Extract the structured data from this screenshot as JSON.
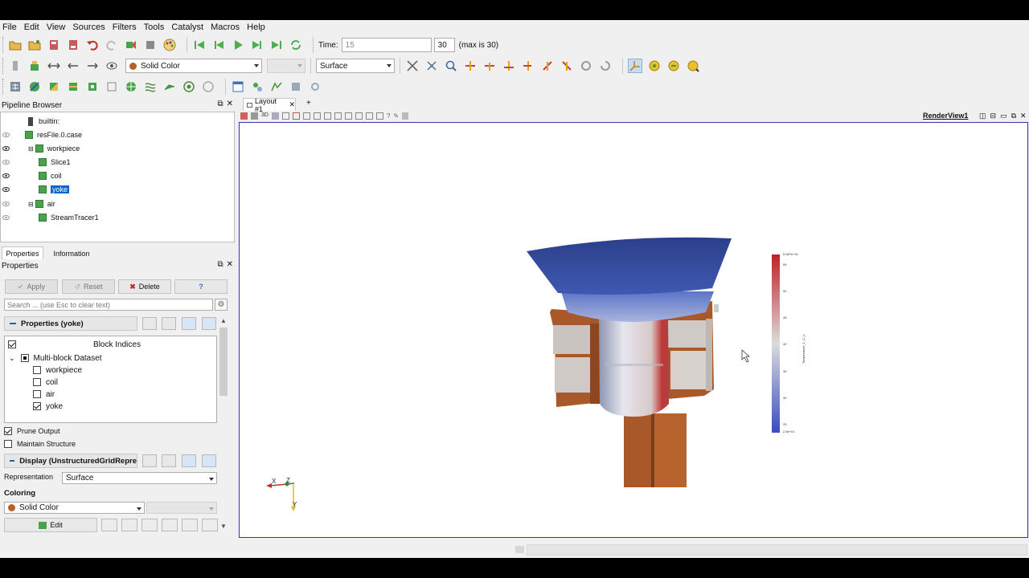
{
  "menu": [
    "File",
    "Edit",
    "View",
    "Sources",
    "Filters",
    "Tools",
    "Catalyst",
    "Macros",
    "Help"
  ],
  "toolbar": {
    "time_label": "Time:",
    "time_value": "15",
    "timestep_value": "30",
    "max_label": "(max is 30)",
    "coloring_combo": "Solid Color",
    "representation_combo": "Surface"
  },
  "pipeline": {
    "title": "Pipeline Browser",
    "items": [
      {
        "label": "builtin:"
      },
      {
        "label": "resFile.0.case"
      },
      {
        "label": "workpiece"
      },
      {
        "label": "Slice1"
      },
      {
        "label": "coil"
      },
      {
        "label": "yoke"
      },
      {
        "label": "air"
      },
      {
        "label": "StreamTracer1"
      }
    ]
  },
  "tabs": {
    "properties": "Properties",
    "information": "Information"
  },
  "properties": {
    "title": "Properties",
    "apply": "Apply",
    "reset": "Reset",
    "delete": "Delete",
    "help": "?",
    "search_placeholder": "Search ... (use Esc to clear text)",
    "section_title": "Properties (yoke)",
    "block_indices": "Block Indices",
    "multiblock": "Multi-block Dataset",
    "blocks": [
      "workpiece",
      "coil",
      "air",
      "yoke"
    ],
    "prune_output": "Prune Output",
    "maintain_structure": "Maintain Structure",
    "display_title": "Display (UnstructuredGridRepre",
    "representation_label": "Representation",
    "representation_value": "Surface",
    "coloring_label": "Coloring",
    "coloring_value": "Solid Color",
    "edit_button": "Edit"
  },
  "layout": {
    "tab_label": "Layout #1",
    "add_tab": "+",
    "render_view": "RenderView1"
  },
  "colorbar": {
    "max_label": "5.687e+01",
    "min_label": "2.5e+01",
    "ticks": [
      "55",
      "50",
      "45",
      "40",
      "35",
      "30",
      "25"
    ],
    "title": "Temperature_1_C_n",
    "high_color": "#c0202a",
    "mid_color": "#dcdcdc",
    "low_color": "#3a4cc0"
  },
  "axes": {
    "x": "X",
    "y": "Y",
    "z": "Z"
  },
  "colors": {
    "accent": "#0a64d2",
    "model_brown": "#a9582a",
    "model_blue": "#2f4c9a"
  }
}
